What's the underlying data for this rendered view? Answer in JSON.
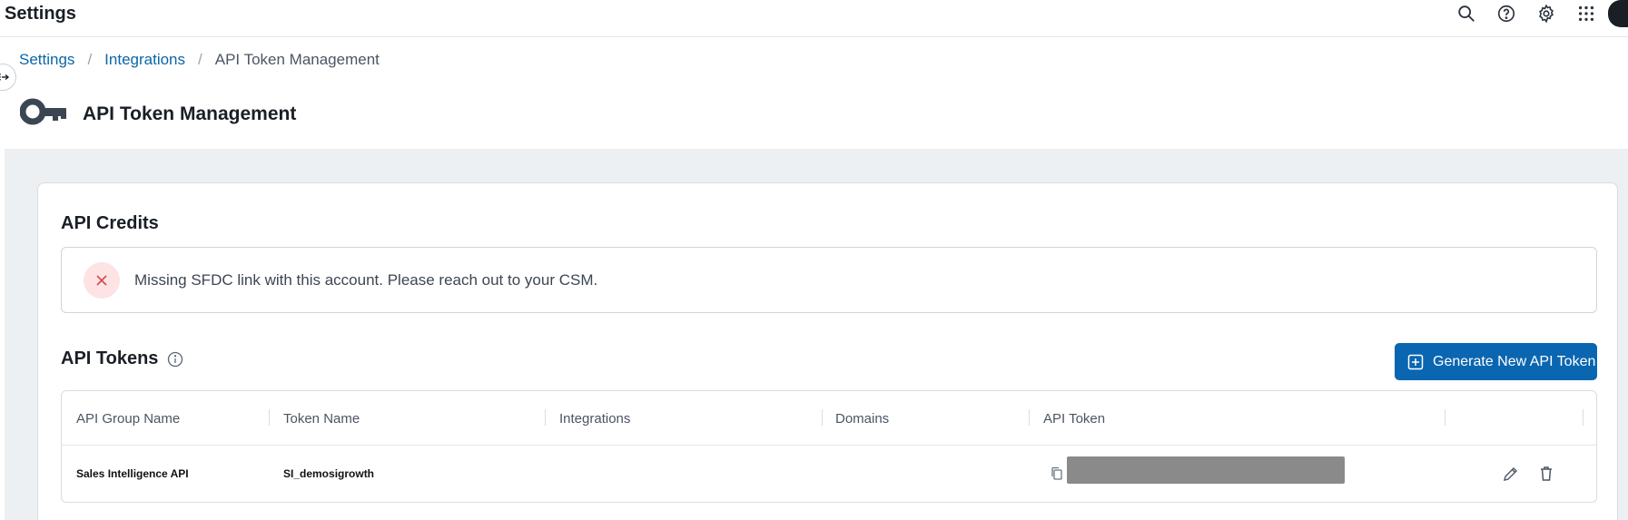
{
  "app": {
    "title": "Settings"
  },
  "top_icons": [
    "search-icon",
    "help-icon",
    "gear-icon",
    "apps-grid-icon"
  ],
  "breadcrumb": {
    "items": [
      {
        "label": "Settings"
      },
      {
        "label": "Integrations"
      },
      {
        "label": "API Token Management"
      }
    ],
    "separator": "/"
  },
  "page": {
    "title": "API Token Management",
    "icon": "key-icon"
  },
  "credits": {
    "title": "API Credits",
    "alert_text": "Missing SFDC link with this account. Please reach out to your CSM.",
    "alert_icon": "close-icon"
  },
  "tokens": {
    "title": "API Tokens",
    "generate_label": "Generate New API Token",
    "columns": [
      "API Group Name",
      "Token Name",
      "Integrations",
      "Domains",
      "API Token"
    ],
    "rows": [
      {
        "group": "Sales Intelligence API",
        "token_name": "SI_demosigrowth",
        "integrations": "",
        "domains": ""
      }
    ]
  },
  "colors": {
    "accent": "#0a66b0",
    "link": "#0a66a8",
    "alert_bg": "#fde3e3",
    "alert_icon": "#d94848"
  }
}
